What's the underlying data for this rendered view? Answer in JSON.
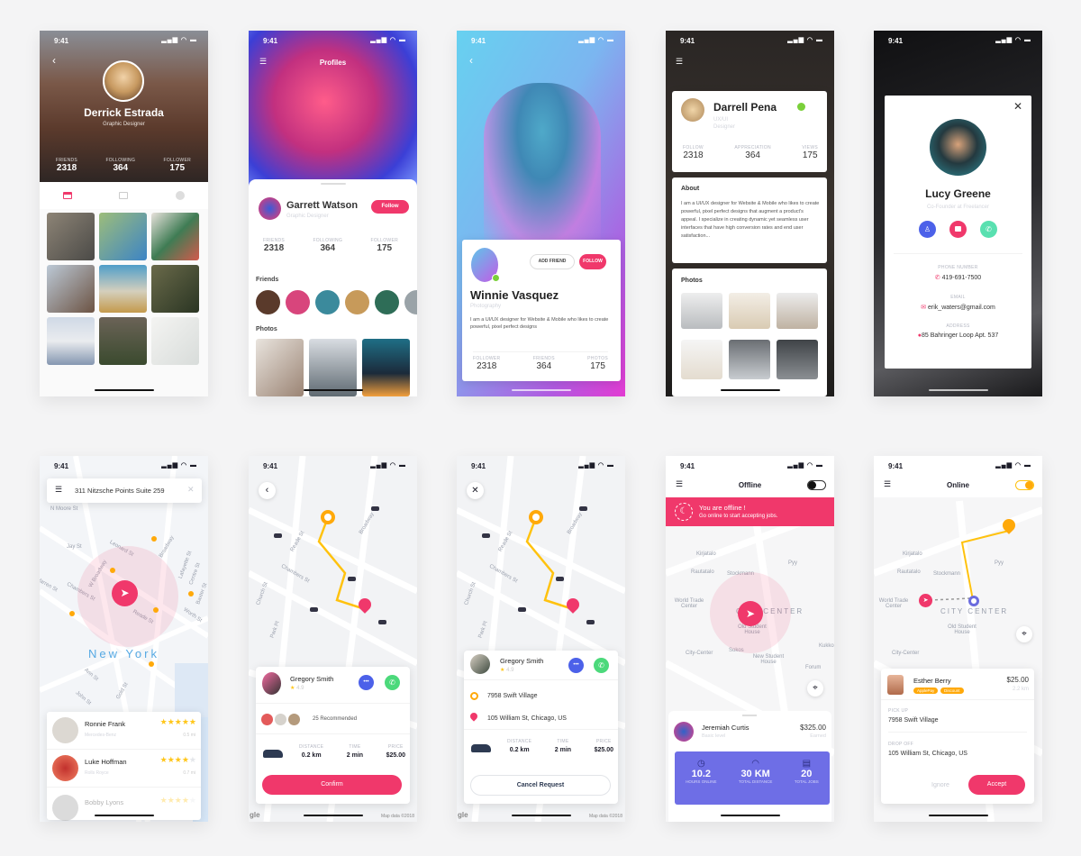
{
  "status_time": "9:41",
  "colors": {
    "accent": "#f0386b",
    "purple": "#6b6cde",
    "orange": "#ffa90a",
    "green": "#4cd97b",
    "blue": "#4c61e9"
  },
  "profile_derrick": {
    "name": "Derrick Estrada",
    "role": "Graphic Designer",
    "stats": [
      {
        "label": "FRIENDS",
        "value": "2318"
      },
      {
        "label": "FOLLOWING",
        "value": "364"
      },
      {
        "label": "FOLLOWER",
        "value": "175"
      }
    ],
    "tabs": [
      "calendar-icon",
      "image-icon",
      "play-icon"
    ]
  },
  "profile_garrett": {
    "title": "Profiles",
    "name": "Garrett Watson",
    "role": "Graphic Designer",
    "follow": "Follow",
    "stats": [
      {
        "label": "FRIENDS",
        "value": "2318"
      },
      {
        "label": "FOLLOWING",
        "value": "364"
      },
      {
        "label": "FOLLOWER",
        "value": "175"
      }
    ],
    "friends_label": "Friends",
    "photos_label": "Photos"
  },
  "profile_winnie": {
    "name": "Winnie Vasquez",
    "role": "Photography",
    "add_friend": "ADD FRIEND",
    "follow": "FOLLOW",
    "bio": "I am a UI/UX designer for Website & Mobile who likes to create powerful, pixel perfect designs",
    "stats": [
      {
        "label": "FOLLOWER",
        "value": "2318"
      },
      {
        "label": "FRIENDS",
        "value": "364"
      },
      {
        "label": "PHOTOS",
        "value": "175"
      }
    ]
  },
  "profile_darrell": {
    "name": "Darrell Pena",
    "role": "UX/UI Designer",
    "stats": [
      {
        "label": "FOLLOW",
        "value": "2318"
      },
      {
        "label": "APPRECIATION",
        "value": "364"
      },
      {
        "label": "VIEWS",
        "value": "175"
      }
    ],
    "about_title": "About",
    "about": "I am a UI/UX designer for Website & Mobile who likes to create powerful, pixel perfect designs that augment a product's appeal. I specialize in creating dynamic yet seamless user interfaces that have high conversion rates and end user satisfaction...",
    "photos_title": "Photos"
  },
  "profile_lucy": {
    "name": "Lucy Greene",
    "role": "Co-Founder at Freelancer",
    "phone_label": "PHONE NUMBER",
    "phone": "419-691-7500",
    "email_label": "EMAIL",
    "email": "erik_waters@gmail.com",
    "address_label": "ADDRESS",
    "address": "85 Bahringer Loop Apt. 537"
  },
  "map_search": {
    "address": "311 Nitzsche Points Suite 259",
    "city": "New York",
    "streets": [
      "N Moore St",
      "Jay St",
      "Leonard St",
      "W Broadway",
      "Chambers St",
      "Reade St",
      "Broadway",
      "Lafayette St",
      "Centre St",
      "Baxter St",
      "Worth St",
      "Warren St",
      "Ann St",
      "John St",
      "Gold St"
    ],
    "drivers": [
      {
        "name": "Ronnie Frank",
        "car": "Mercedes-Benz",
        "distance": "0.5 mi",
        "rating": 5
      },
      {
        "name": "Luke Hoffman",
        "car": "Rolls Royce",
        "distance": "0.7 mi",
        "rating": 4
      },
      {
        "name": "Bobby Lyons",
        "rating": 4
      }
    ]
  },
  "ride_confirm": {
    "driver": "Gregory Smith",
    "rating": "4.9",
    "recommended": "25 Recommended",
    "stats": [
      {
        "label": "DISTANCE",
        "value": "0.2 km"
      },
      {
        "label": "TIME",
        "value": "2 min"
      },
      {
        "label": "PRICE",
        "value": "$25.00"
      }
    ],
    "confirm": "Confirm",
    "streets": [
      "Reade St",
      "Chambers St",
      "Broadway",
      "Church St",
      "Park Pl"
    ],
    "google": "gle",
    "map_data": "Map data ©2018"
  },
  "ride_request": {
    "driver": "Gregory Smith",
    "rating": "4.9",
    "pickup": "7958 Swift Village",
    "dropoff": "105 William St, Chicago, US",
    "stats": [
      {
        "label": "DISTANCE",
        "value": "0.2 km"
      },
      {
        "label": "TIME",
        "value": "2 min"
      },
      {
        "label": "PRICE",
        "value": "$25.00"
      }
    ],
    "cancel": "Cancel Request",
    "streets": [
      "Reade St",
      "Chambers St",
      "Broadway",
      "Church St",
      "Park Pl"
    ],
    "google": "gle",
    "map_data": "Map data ©2018"
  },
  "driver_offline": {
    "title": "Offline",
    "toggle_on": false,
    "banner_title": "You are offline !",
    "banner_sub": "Go online to start accepting jobs.",
    "map_labels": [
      "Kirjatalo",
      "Rautatalo",
      "Stockmann",
      "World Trade Center",
      "City-Center",
      "Sokos",
      "New Student House",
      "Forum",
      "Pyy",
      "Kukko",
      "Old Student House",
      "CITY CENTER"
    ],
    "driver": "Jeremiah Curtis",
    "level": "Basic level",
    "earned": "$325.00",
    "earned_label": "Earned",
    "stats": [
      {
        "value": "10.2",
        "label": "HOURS ONLINE",
        "icon": "clock-icon"
      },
      {
        "value": "30 KM",
        "label": "TOTAL DISTANCE",
        "icon": "speedometer-icon"
      },
      {
        "value": "20",
        "label": "TOTAL JOBS",
        "icon": "receipt-icon"
      }
    ]
  },
  "driver_online": {
    "title": "Online",
    "toggle_on": true,
    "map_labels": [
      "Kirjatalo",
      "Rautatalo",
      "Stockmann",
      "World Trade Center",
      "City-Center",
      "Pyy",
      "Old Student House",
      "CITY CENTER"
    ],
    "rider": "Esther Berry",
    "tags": [
      "ApplePay",
      "Discount"
    ],
    "price": "$25.00",
    "distance": "2.2 km",
    "pickup_label": "PICK UP",
    "pickup": "7958 Swift Village",
    "dropoff_label": "DROP OFF",
    "dropoff": "105 William St, Chicago, US",
    "ignore": "Ignore",
    "accept": "Accept"
  }
}
